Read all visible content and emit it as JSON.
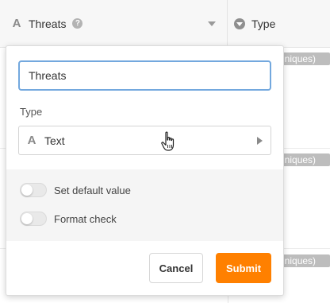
{
  "columns": {
    "threats": {
      "icon": "text-type-icon",
      "label": "Threats",
      "help_icon": "question-icon",
      "help_glyph": "?"
    },
    "type": {
      "icon": "single-select-icon",
      "label": "Type"
    }
  },
  "cell_tags": [
    "chniques)",
    "chniques)",
    "chniques)"
  ],
  "popover": {
    "name_value": "Threats",
    "type_caption": "Type",
    "type_select": {
      "icon": "text-type-icon",
      "glyph": "A",
      "value": "Text",
      "arrow_icon": "chevron-right-icon"
    },
    "options": {
      "default_value": {
        "label": "Set default value",
        "enabled": false
      },
      "format_check": {
        "label": "Format check",
        "enabled": false
      }
    },
    "cancel_label": "Cancel",
    "submit_label": "Submit"
  },
  "colors": {
    "accent": "#ff8000",
    "input_focus": "#73a8de",
    "tag_bg": "#bdbdbd"
  }
}
